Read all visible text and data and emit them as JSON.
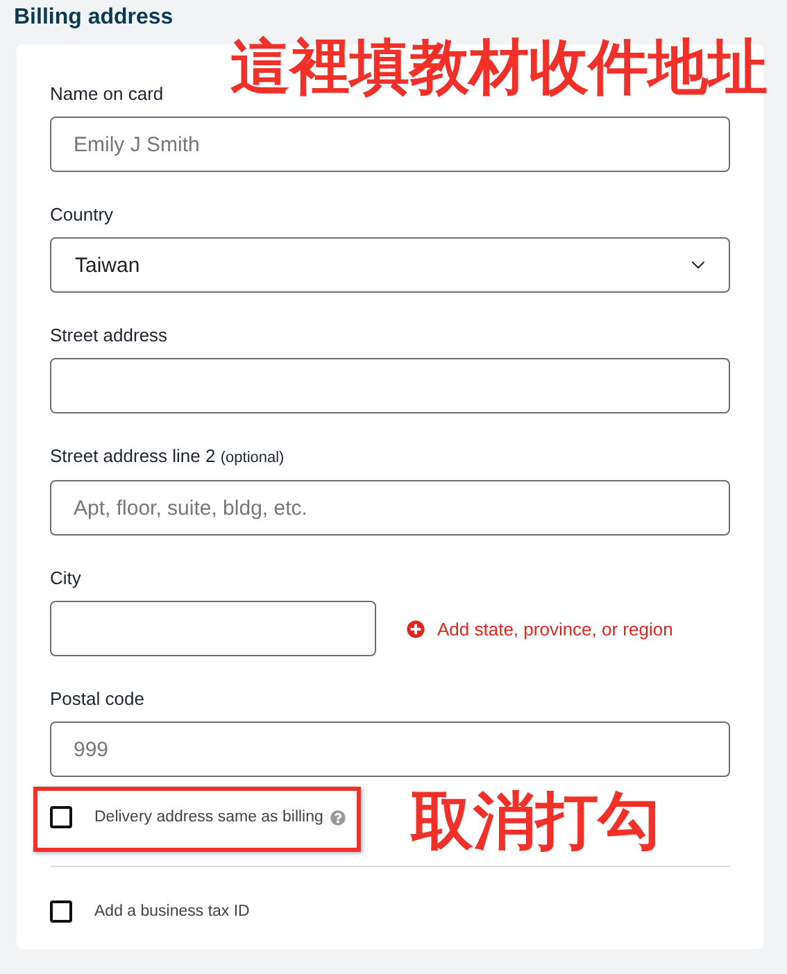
{
  "section_title": "Billing address",
  "annotations": [
    {
      "text": "這裡填教材收件地址",
      "kind": "top"
    },
    {
      "text": "取消打勾",
      "kind": "checkbox"
    }
  ],
  "fields": [
    {
      "label": "Name on card",
      "kind": "text",
      "placeholder": "Emily J Smith"
    },
    {
      "label": "Country",
      "kind": "select",
      "value": "Taiwan"
    },
    {
      "label": "Street address",
      "kind": "text"
    },
    {
      "label": "Street address line 2",
      "note": "(optional)",
      "kind": "text",
      "placeholder": "Apt, floor, suite, bldg, etc."
    },
    {
      "label": "City",
      "kind": "text",
      "link": "Add state, province, or region"
    },
    {
      "label": "Postal code",
      "kind": "text",
      "placeholder": "999"
    }
  ],
  "checkboxes": [
    {
      "label": "Delivery address same as billing",
      "checked": false,
      "help": true,
      "highlighted": true
    },
    {
      "label": "Add a business tax ID",
      "checked": false,
      "help": false,
      "highlighted": false
    }
  ]
}
